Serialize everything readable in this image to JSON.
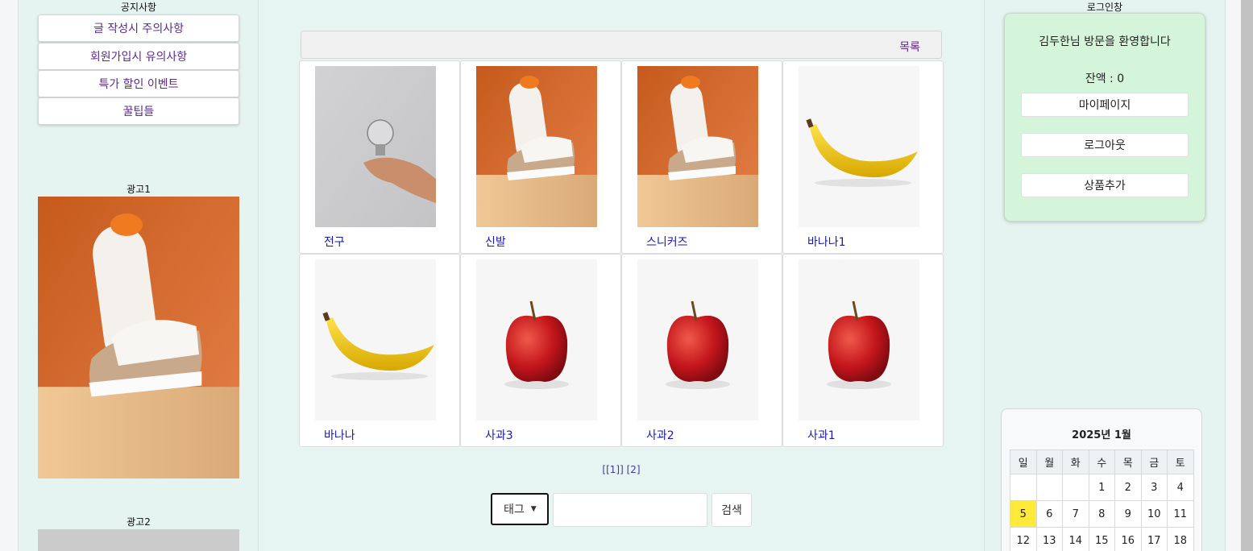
{
  "notice": {
    "title": "공지사항",
    "items": [
      {
        "label": "글 작성시 주의사항"
      },
      {
        "label": "회원가입시 유의사항"
      },
      {
        "label": "특가 할인 이벤트"
      },
      {
        "label": "꿀팁들"
      }
    ]
  },
  "ads": [
    {
      "title": "광고1",
      "image": "sneakers-on-orange-background"
    },
    {
      "title": "광고2",
      "image": "gray-image-partial"
    }
  ],
  "main": {
    "list_link": "목록",
    "products": [
      {
        "name": "전구",
        "image": "lightbulb-in-hand"
      },
      {
        "name": "신발",
        "image": "sneakers"
      },
      {
        "name": "스니커즈",
        "image": "sneakers"
      },
      {
        "name": "바나나1",
        "image": "banana"
      },
      {
        "name": "바나나",
        "image": "banana"
      },
      {
        "name": "사과3",
        "image": "red-apple"
      },
      {
        "name": "사과2",
        "image": "red-apple"
      },
      {
        "name": "사과1",
        "image": "red-apple"
      }
    ],
    "pagination": {
      "current": "[[1]]",
      "next": "[2]"
    },
    "search": {
      "select_value": "태그",
      "input_value": "",
      "button_label": "검색"
    }
  },
  "login": {
    "title": "로그인창",
    "welcome": "김두한님 방문을 환영합니다",
    "balance": "잔액 : 0",
    "buttons": [
      {
        "label": "마이페이지"
      },
      {
        "label": "로그아웃"
      },
      {
        "label": "상품추가"
      }
    ]
  },
  "calendar": {
    "title": "2025년 1월",
    "weekdays": [
      "일",
      "월",
      "화",
      "수",
      "목",
      "금",
      "토"
    ],
    "weeks": [
      [
        "",
        "",
        "",
        "1",
        "2",
        "3",
        "4"
      ],
      [
        "5",
        "6",
        "7",
        "8",
        "9",
        "10",
        "11"
      ],
      [
        "12",
        "13",
        "14",
        "15",
        "16",
        "17",
        "18"
      ]
    ],
    "today": "5",
    "today_color": "#ffe93b"
  },
  "colors": {
    "link_purple": "#5a2a8c",
    "product_name_blue": "#1a1aa6",
    "login_bg": "#d5f5da",
    "page_bg": "#e6f5f1"
  }
}
